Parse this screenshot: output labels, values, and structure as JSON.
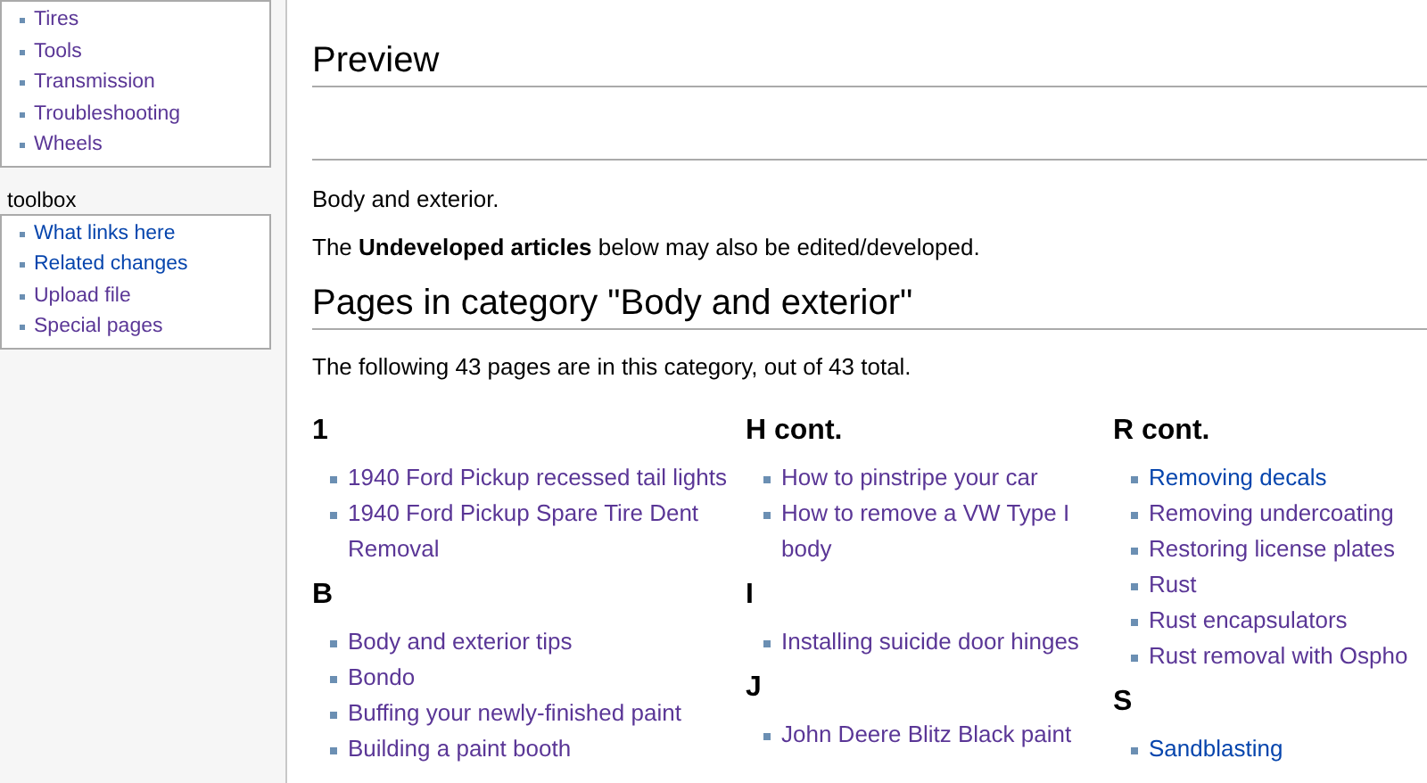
{
  "sidebar": {
    "portlets": [
      {
        "items": [
          {
            "label": "Tires",
            "visited": true
          },
          {
            "label": "Tools",
            "visited": true
          },
          {
            "label": "Transmission",
            "visited": true
          },
          {
            "label": "Troubleshooting",
            "visited": true
          },
          {
            "label": "Wheels",
            "visited": true
          }
        ]
      },
      {
        "heading": "toolbox",
        "items": [
          {
            "label": "What links here",
            "visited": false
          },
          {
            "label": "Related changes",
            "visited": false
          },
          {
            "label": "Upload file",
            "visited": true
          },
          {
            "label": "Special pages",
            "visited": true
          }
        ]
      }
    ]
  },
  "preview": {
    "heading": "Preview"
  },
  "intro": [
    "Body and exterior.",
    "The **Undeveloped articles** below may also be edited/developed."
  ],
  "category": {
    "heading": "Pages in category \"Body and exterior\"",
    "summary": "The following 43 pages are in this category, out of 43 total.",
    "columns": [
      [
        {
          "heading": "1",
          "items": [
            {
              "label": "1940 Ford Pickup recessed tail lights",
              "visited": true
            },
            {
              "label": "1940 Ford Pickup Spare Tire Dent Removal",
              "visited": true
            }
          ]
        },
        {
          "heading": "B",
          "items": [
            {
              "label": "Body and exterior tips",
              "visited": true
            },
            {
              "label": "Bondo",
              "visited": true
            },
            {
              "label": "Buffing your newly-finished paint",
              "visited": true
            },
            {
              "label": "Building a paint booth",
              "visited": true
            }
          ]
        }
      ],
      [
        {
          "heading": "H cont.",
          "items": [
            {
              "label": "How to pinstripe your car",
              "visited": true
            },
            {
              "label": "How to remove a VW Type I body",
              "visited": true
            }
          ]
        },
        {
          "heading": "I",
          "items": [
            {
              "label": "Installing suicide door hinges",
              "visited": true
            }
          ]
        },
        {
          "heading": "J",
          "items": [
            {
              "label": "John Deere Blitz Black paint",
              "visited": true
            }
          ]
        }
      ],
      [
        {
          "heading": "R cont.",
          "items": [
            {
              "label": "Removing decals",
              "visited": false
            },
            {
              "label": "Removing undercoating",
              "visited": true
            },
            {
              "label": "Restoring license plates",
              "visited": true
            },
            {
              "label": "Rust",
              "visited": true
            },
            {
              "label": "Rust encapsulators",
              "visited": true
            },
            {
              "label": "Rust removal with Ospho",
              "visited": true
            }
          ]
        },
        {
          "heading": "S",
          "items": [
            {
              "label": "Sandblasting",
              "visited": false
            }
          ]
        }
      ]
    ]
  }
}
